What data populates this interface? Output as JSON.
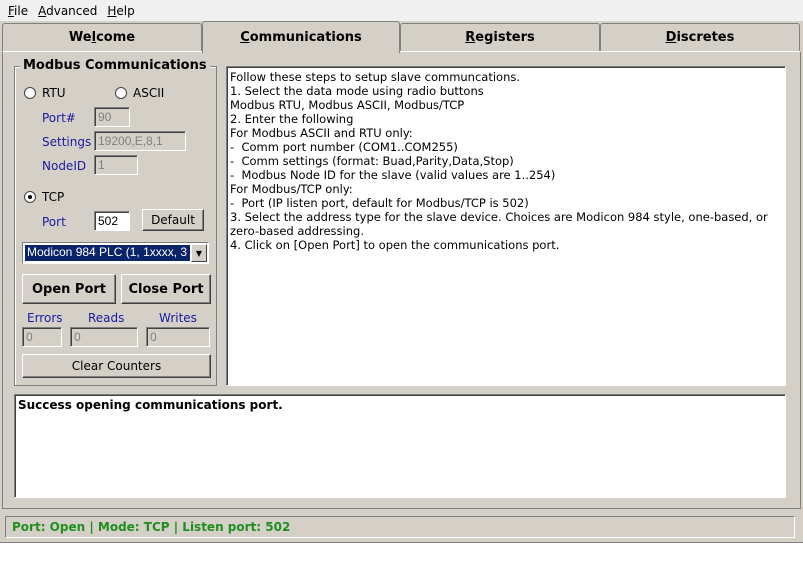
{
  "menu": [
    {
      "pre": "",
      "u": "F",
      "post": "ile"
    },
    {
      "pre": "",
      "u": "A",
      "post": "dvanced"
    },
    {
      "pre": "",
      "u": "H",
      "post": "elp"
    }
  ],
  "tabs": [
    {
      "pre": "We",
      "u": "l",
      "post": "come",
      "active": false
    },
    {
      "pre": "",
      "u": "C",
      "post": "ommunications",
      "active": true
    },
    {
      "pre": "",
      "u": "R",
      "post": "egisters",
      "active": false
    },
    {
      "pre": "",
      "u": "D",
      "post": "iscretes",
      "active": false
    }
  ],
  "group": {
    "title": "Modbus Communications",
    "rtu_label": "RTU",
    "ascii_label": "ASCII",
    "port_num_label": "Port#",
    "port_num_value": "90",
    "settings_label": "Settings",
    "settings_value": "19200,E,8,1",
    "nodeid_label": "NodeID",
    "nodeid_value": "1",
    "tcp_label": "TCP",
    "tcp_port_label": "Port",
    "tcp_port_value": "502",
    "default_button": "Default",
    "address_select": "Modicon 984 PLC (1, 1xxxx, 3",
    "open_port_button": "Open Port",
    "close_port_button": "Close Port",
    "errors_label": "Errors",
    "reads_label": "Reads",
    "writes_label": "Writes",
    "errors_value": "0",
    "reads_value": "0",
    "writes_value": "0",
    "clear_counters_button": "Clear Counters",
    "selected_mode": "TCP"
  },
  "instructions": [
    "Follow these steps to setup slave communcations.",
    "",
    "1. Select the data mode using radio buttons",
    "",
    "Modbus RTU, Modbus ASCII, Modbus/TCP",
    "",
    "2. Enter the following",
    "",
    "For Modbus ASCII and RTU only:",
    "-  Comm port number (COM1..COM255)",
    "-  Comm settings (format: Buad,Parity,Data,Stop)",
    "-  Modbus Node ID for the slave (valid values are 1..254)",
    "",
    "For Modbus/TCP only:",
    "-  Port (IP listen port, default for Modbus/TCP is 502)",
    "",
    "3. Select the address type for the slave device. Choices are Modicon 984 style, one-based, or",
    "zero-based addressing.",
    "",
    "4. Click on [Open Port] to open the communications port."
  ],
  "log": [
    "Success opening communications port."
  ],
  "status": "Port: Open | Mode: TCP | Listen port: 502",
  "colors": {
    "status_text": "#1f8f1f",
    "label_blue": "#1a1a9f",
    "selection": "#0a246a"
  }
}
